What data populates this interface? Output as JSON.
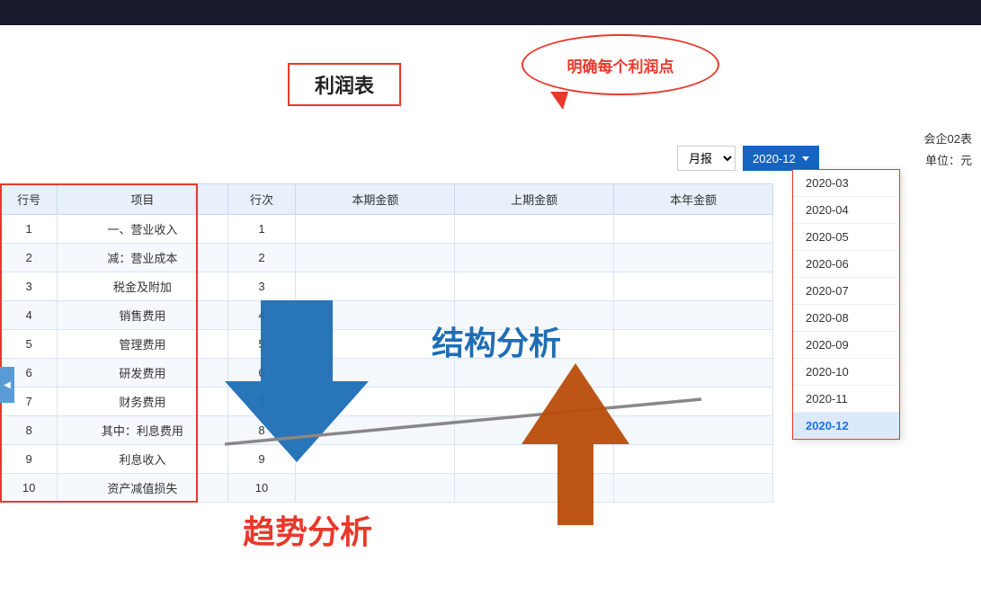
{
  "topBar": {
    "bg": "#1a1a2e"
  },
  "annotation": {
    "text": "明确每个利润点"
  },
  "title": {
    "label": "利润表"
  },
  "controls": {
    "company": "会企02表",
    "unit": "单位：元",
    "period_label": "月报",
    "date_selected": "2020-12",
    "dates": [
      "2020-03",
      "2020-04",
      "2020-05",
      "2020-06",
      "2020-07",
      "2020-08",
      "2020-09",
      "2020-10",
      "2020-11",
      "2020-12"
    ]
  },
  "table": {
    "headers": [
      "行号",
      "项目",
      "行次",
      "本期金额",
      "上期金额",
      "本年金额"
    ],
    "rows": [
      {
        "hang": "1",
        "item": "一、营业收入",
        "ci": "1",
        "current": "",
        "prev": "",
        "year": ""
      },
      {
        "hang": "2",
        "item": "减：营业成本",
        "ci": "2",
        "current": "",
        "prev": "",
        "year": ""
      },
      {
        "hang": "3",
        "item": "税金及附加",
        "ci": "3",
        "current": "",
        "prev": "",
        "year": ""
      },
      {
        "hang": "4",
        "item": "销售费用",
        "ci": "4",
        "current": "",
        "prev": "",
        "year": ""
      },
      {
        "hang": "5",
        "item": "管理费用",
        "ci": "5",
        "current": "",
        "prev": "",
        "year": ""
      },
      {
        "hang": "6",
        "item": "研发费用",
        "ci": "6",
        "current": "",
        "prev": "",
        "year": ""
      },
      {
        "hang": "7",
        "item": "财务费用",
        "ci": "7",
        "current": "",
        "prev": "",
        "year": ""
      },
      {
        "hang": "8",
        "item": "其中：利息费用",
        "ci": "8",
        "current": "",
        "prev": "",
        "year": ""
      },
      {
        "hang": "9",
        "item": "利息收入",
        "ci": "9",
        "current": "",
        "prev": "",
        "year": ""
      },
      {
        "hang": "10",
        "item": "资产减值损失",
        "ci": "10",
        "current": "",
        "prev": "",
        "year": ""
      }
    ]
  },
  "overlayText": {
    "jiegou": "结构分析",
    "qushi": "趋势分析"
  }
}
